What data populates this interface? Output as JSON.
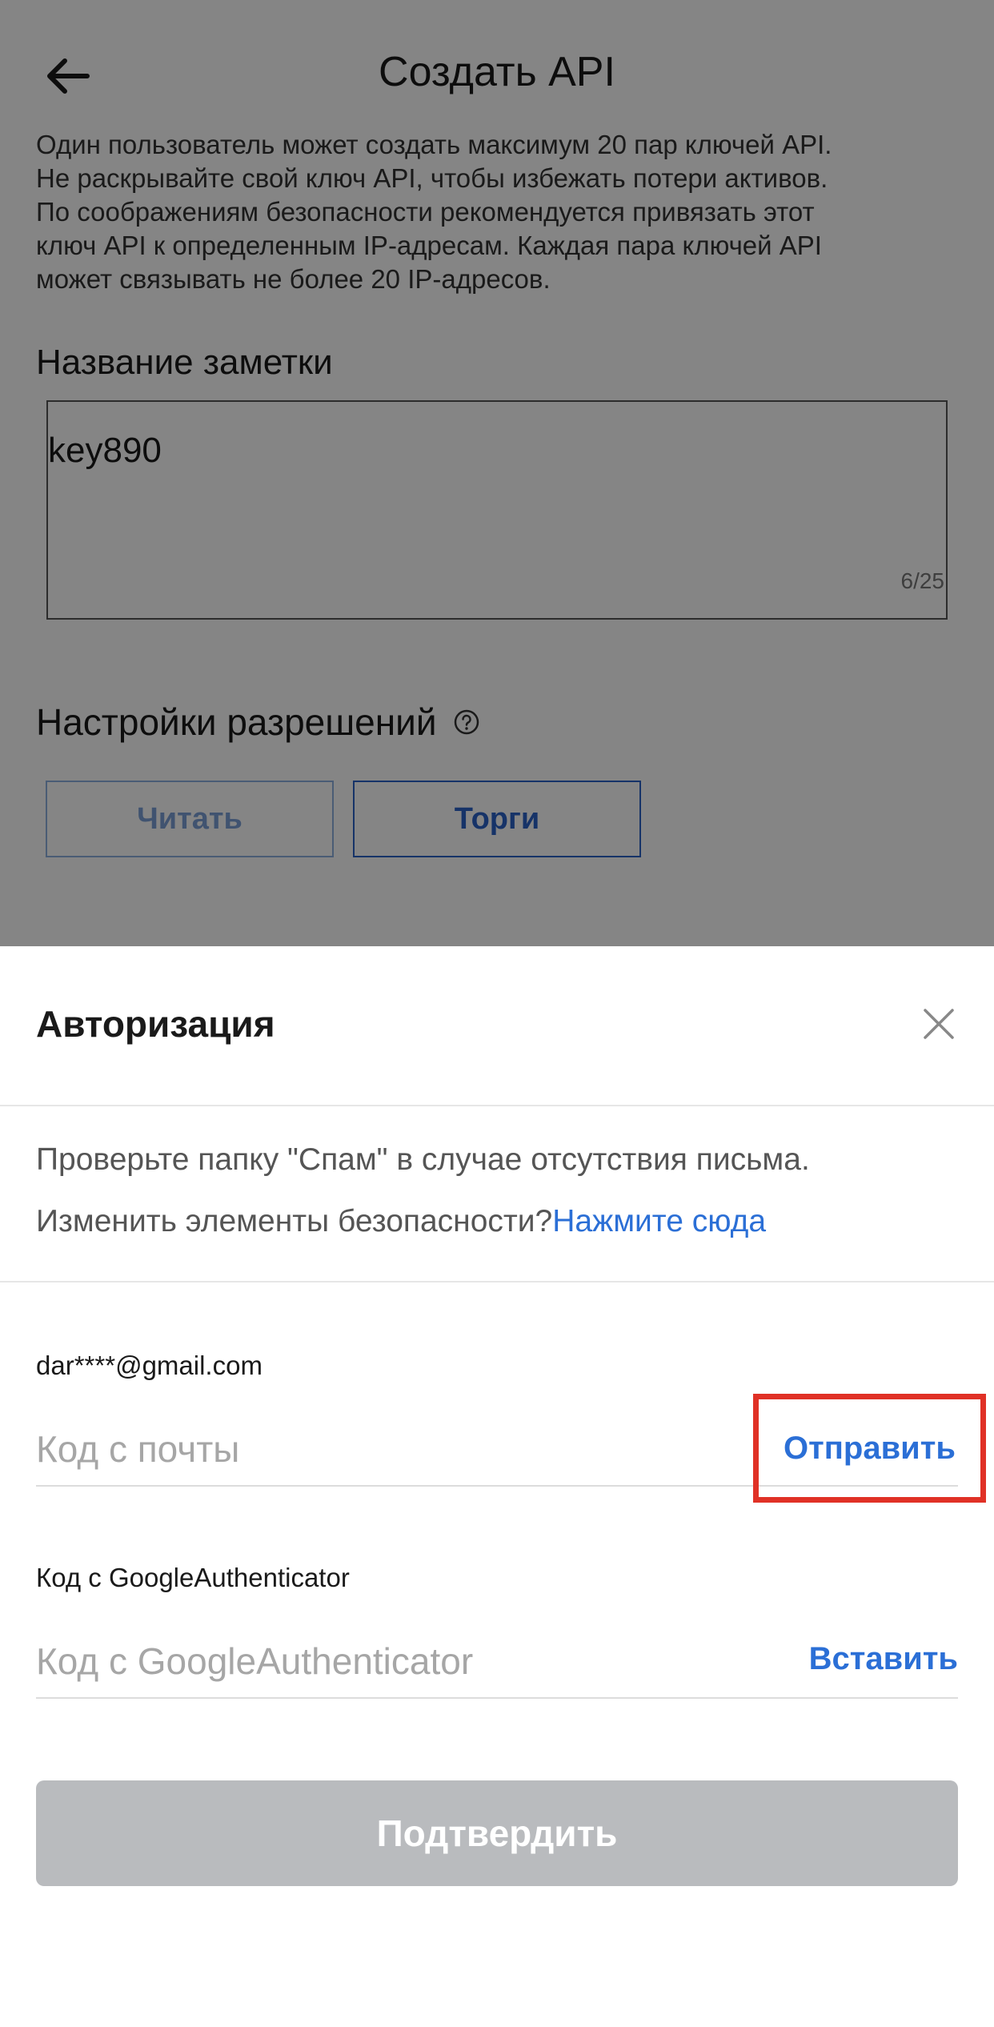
{
  "header": {
    "title": "Создать API"
  },
  "intro": {
    "lines": [
      "Один пользователь может создать максимум 20 пар ключей API.",
      "Не раскрывайте свой ключ API, чтобы избежать потери активов.",
      "По соображениям безопасности рекомендуется привязать этот",
      "ключ API к определенным IP-адресам. Каждая пара ключей API",
      "может связывать не более 20 IP-адресов."
    ]
  },
  "note": {
    "label": "Название заметки",
    "value": "key890",
    "counter": "6/25"
  },
  "permissions": {
    "label": "Настройки разрешений",
    "read_label": "Читать",
    "trade_label": "Торги"
  },
  "sheet": {
    "title": "Авторизация",
    "spam_hint": "Проверьте папку \"Спам\" в случае отсутствия письма.",
    "security_question": "Изменить элементы безопасности?",
    "security_link": "Нажмите сюда",
    "email": "dar****@gmail.com",
    "email_code_placeholder": "Код с почты",
    "send_label": "Отправить",
    "ga_label": "Код с GoogleAuthenticator",
    "ga_placeholder": "Код с GoogleAuthenticator",
    "paste_label": "Вставить",
    "confirm_label": "Подтвердить"
  },
  "icons": {
    "back": "arrow-left-icon",
    "help": "question-circle-icon",
    "close": "close-icon"
  },
  "colors": {
    "link": "#2b6fd6",
    "highlight_border": "#e03126",
    "confirm_disabled": "#b9bbbe",
    "overlay": "rgba(0,0,0,0.48)"
  }
}
